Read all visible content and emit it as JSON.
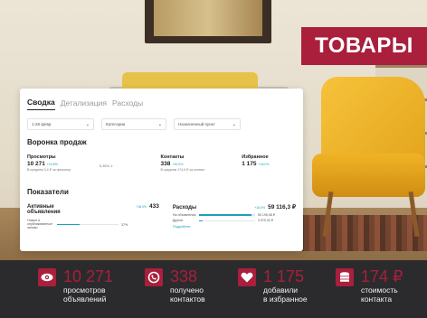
{
  "banner": {
    "title": "ТОВАРЫ"
  },
  "card": {
    "tabs": [
      "Сводка",
      "Детализация",
      "Расходы"
    ],
    "filters": [
      {
        "label": "1-28 февр"
      },
      {
        "label": "Категории"
      },
      {
        "label": "Назначенный пункт"
      }
    ],
    "funnel": {
      "title": "Воронка продаж",
      "delta_note": "5,35% ≥",
      "columns": [
        {
          "label": "Просмотры",
          "value": "10 271",
          "pct": "+10,8%",
          "note": "В среднем 3,4 ₽ за просмотр"
        },
        {
          "label": "Контакты",
          "value": "338",
          "pct": "+30,0%",
          "note": "В среднем 174,9 ₽ за контакт"
        },
        {
          "label": "Избранное",
          "value": "1 175",
          "pct": "+18,0%",
          "note": ""
        }
      ]
    },
    "metrics": {
      "title": "Показатели",
      "active": {
        "label": "Активные объявления",
        "pct": "+18,0%",
        "value": "433",
        "bar_label": "Новые и опубликованные заново",
        "bar_value": "37%",
        "bar_fill": 0.37
      },
      "expenses": {
        "label": "Расходы",
        "pct": "+16,0%",
        "value": "59 116,3 ₽",
        "rows": [
          {
            "label": "На объявления",
            "value": "55 195,98 ₽",
            "fill": 0.93
          },
          {
            "label": "Другие",
            "value": "3 570,32 ₽",
            "fill": 0.06
          }
        ],
        "more": "Подробнее"
      }
    }
  },
  "stats": [
    {
      "icon": "eye-icon",
      "number": "10 271",
      "line1": "просмотров",
      "line2": "объявлений"
    },
    {
      "icon": "phone-icon",
      "number": "338",
      "line1": "получено",
      "line2": "контактов"
    },
    {
      "icon": "heart-icon",
      "number": "1 175",
      "line1": "добавили",
      "line2": "в избранное"
    },
    {
      "icon": "coins-icon",
      "number": "174 ₽",
      "line1": "стоимость",
      "line2": "контакта"
    }
  ],
  "colors": {
    "accent": "#a91f3c",
    "teal": "#1fa0b8",
    "dark": "#2b2b2d"
  }
}
